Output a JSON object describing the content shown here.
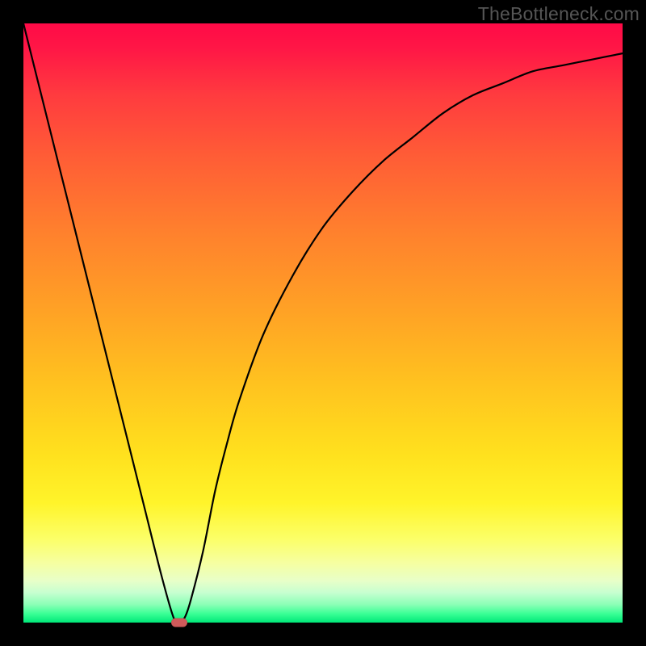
{
  "watermark": "TheBottleneck.com",
  "colors": {
    "frame": "#000000",
    "curve": "#000000",
    "marker": "#cf5a5a",
    "gradient_top": "#ff0a47",
    "gradient_bottom": "#00e878"
  },
  "chart_data": {
    "type": "line",
    "title": "",
    "xlabel": "",
    "ylabel": "",
    "xlim": [
      0,
      100
    ],
    "ylim": [
      0,
      100
    ],
    "grid": false,
    "legend": false,
    "series": [
      {
        "name": "bottleneck-curve",
        "x": [
          0,
          4,
          8,
          12,
          16,
          20,
          23,
          25,
          26,
          27,
          28,
          30,
          32,
          34,
          36,
          40,
          45,
          50,
          55,
          60,
          65,
          70,
          75,
          80,
          85,
          90,
          95,
          100
        ],
        "values": [
          100,
          84,
          68,
          52,
          36,
          20,
          8,
          1,
          0,
          1,
          4,
          12,
          22,
          30,
          37,
          48,
          58,
          66,
          72,
          77,
          81,
          85,
          88,
          90,
          92,
          93,
          94,
          95
        ]
      }
    ],
    "annotations": [
      {
        "name": "min-marker",
        "x": 26,
        "y": 0,
        "shape": "rounded-rect",
        "color": "#cf5a5a"
      }
    ]
  }
}
